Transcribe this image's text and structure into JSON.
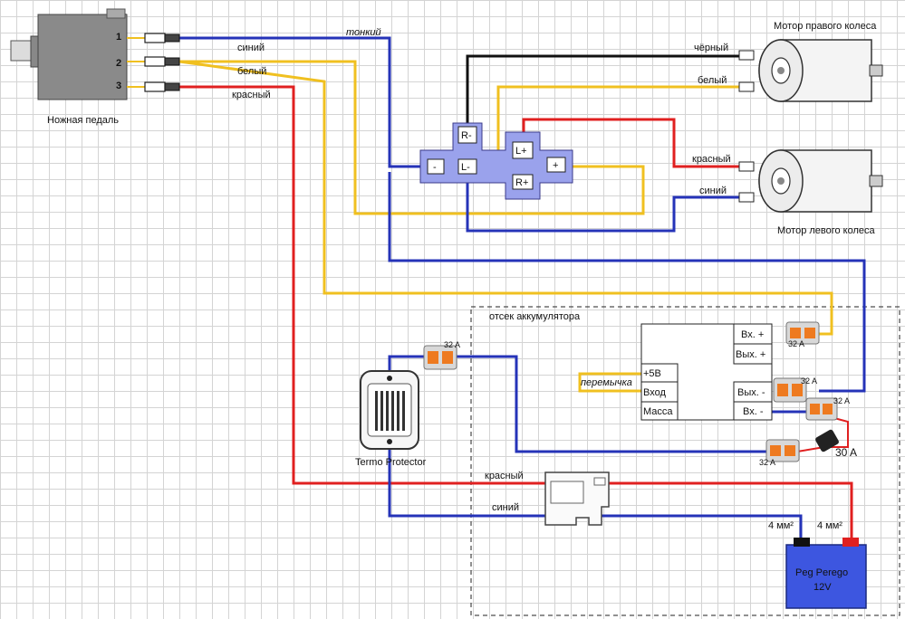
{
  "pedal": {
    "label": "Ножная педаль",
    "pins": [
      "1",
      "2",
      "3"
    ]
  },
  "wires": {
    "blue_top": "синий",
    "thin": "тонкий",
    "white_top": "белый",
    "red_top": "красный",
    "black_right": "чёрный",
    "white_right": "белый",
    "red_right": "красный",
    "blue_right": "синий",
    "red_bottom": "красный",
    "blue_bottom": "синий",
    "jumper": "перемычка"
  },
  "motors": {
    "right": "Мотор правого колеса",
    "left": "Мотор левого колеса"
  },
  "relay_block": {
    "r_minus": "R-",
    "r_plus": "R+",
    "l_plus": "L+",
    "l_minus": "L-",
    "minus": "-",
    "plus": "+"
  },
  "battery_compartment": {
    "title": "отсек аккумулятора"
  },
  "controller": {
    "in_plus": "Вх. +",
    "out_plus": "Вых. +",
    "out_minus": "Вых. -",
    "in_minus": "Вх. -",
    "v5": "+5В",
    "input": "Вход",
    "ground": "Масса"
  },
  "connector_rating": "32 A",
  "fuse_rating": "30 A",
  "termo": {
    "label": "Termo Protector"
  },
  "wire_sizes": {
    "left": "4 мм²",
    "right": "4 мм²"
  },
  "battery": {
    "brand": "Peg Perego",
    "voltage": "12V"
  },
  "colors": {
    "blue": "#2533b8",
    "yellow": "#f0c020",
    "red": "#e02020",
    "black": "#111111",
    "relay_fill": "#9aa2ec",
    "battery_fill": "#3d56e0"
  }
}
